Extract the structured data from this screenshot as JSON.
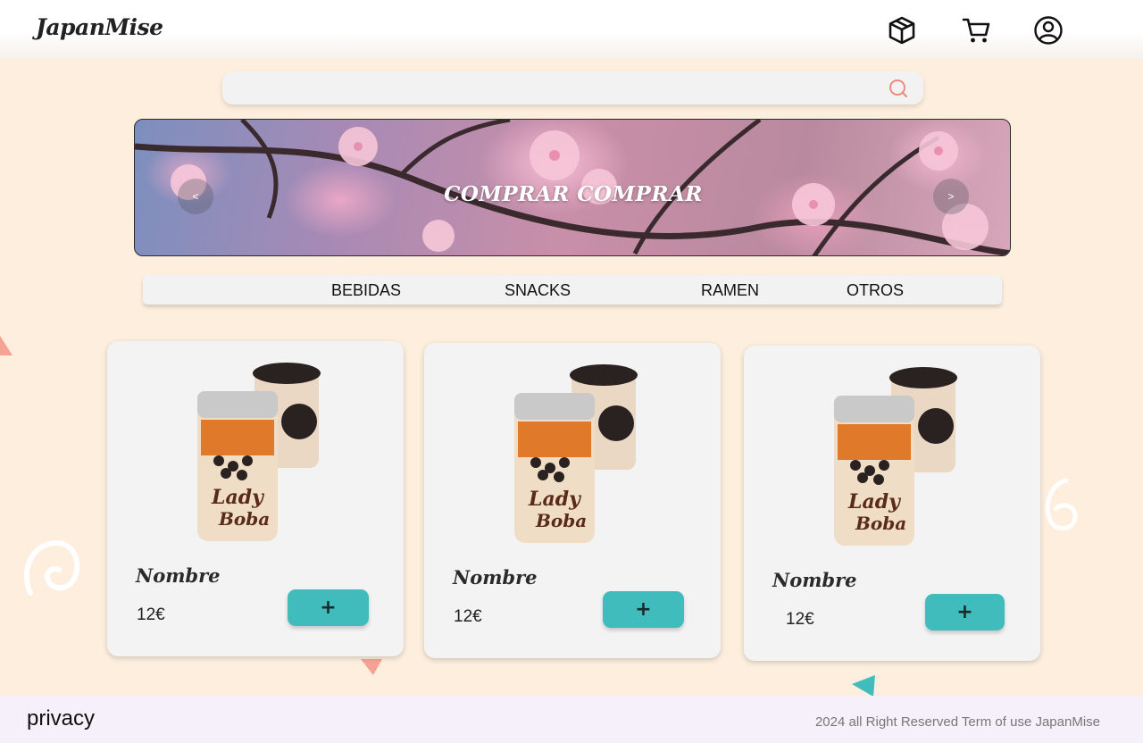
{
  "header": {
    "logo": "JapanMise",
    "icons": [
      "box-icon",
      "cart-icon",
      "user-icon"
    ]
  },
  "search": {
    "placeholder": "",
    "value": ""
  },
  "banner": {
    "title": "COMPRAR COMPRAR",
    "prev_label": "<",
    "next_label": ">"
  },
  "categories": [
    "BEBIDAS",
    "SNACKS",
    "RAMEN",
    "OTROS"
  ],
  "products": [
    {
      "name": "Nombre",
      "price": "12€",
      "add_label": "+"
    },
    {
      "name": "Nombre",
      "price": "12€",
      "add_label": "+"
    },
    {
      "name": "Nombre",
      "price": "12€",
      "add_label": "+"
    }
  ],
  "footer": {
    "privacy": "privacy",
    "copyright": "2024 all Right Reserved Term of use JapanMise"
  },
  "colors": {
    "background": "#fdeedd",
    "accent": "#40bcbc",
    "search_icon": "#f08a80",
    "footer_bg": "#f5f0fa"
  }
}
